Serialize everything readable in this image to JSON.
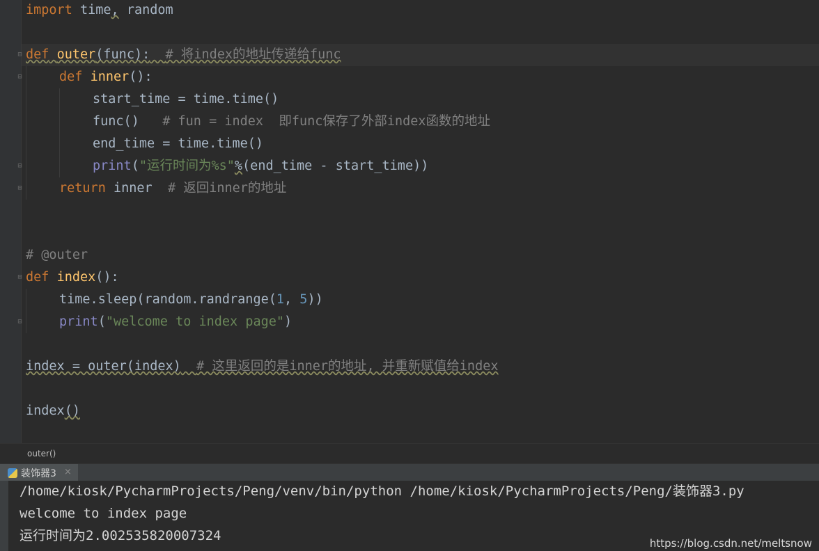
{
  "editor": {
    "line1": {
      "kw": "import",
      "mod1": "time",
      "comma": ",",
      "mod2": "random"
    },
    "line3": {
      "kw": "def",
      "name": "outer",
      "params": "(func):",
      "comment": "# 将index的地址传递给func"
    },
    "line4": {
      "kw": "def",
      "name": "inner",
      "params": "():"
    },
    "line5": {
      "text": "start_time = time.time()"
    },
    "line6": {
      "code": "func()",
      "comment": "# fun = index  即func保存了外部index函数的地址"
    },
    "line7": {
      "text": "end_time = time.time()"
    },
    "line8": {
      "fn": "print",
      "open": "(",
      "str": "\"运行时间为%s\"",
      "pct": "%",
      "rest": "(end_time - start_time))"
    },
    "line9": {
      "kw": "return",
      "val": "inner",
      "comment": "# 返回inner的地址"
    },
    "line12": {
      "comment": "# @outer"
    },
    "line13": {
      "kw": "def",
      "name": "index",
      "params": "():"
    },
    "line14": {
      "pre": "time.sleep(random.randrange(",
      "n1": "1",
      "sep": ", ",
      "n2": "5",
      "post": "))"
    },
    "line15": {
      "fn": "print",
      "open": "(",
      "str": "\"welcome to index page\"",
      "close": ")"
    },
    "line17": {
      "code": "index = outer(index)",
      "comment": "# 这里返回的是inner的地址, 并重新赋值给index"
    },
    "line19": {
      "code": "index",
      "parens": "()"
    }
  },
  "breadcrumb": {
    "text": "outer()"
  },
  "run_panel": {
    "tab_label": "装饰器3",
    "close_label": "×",
    "output": [
      "/home/kiosk/PycharmProjects/Peng/venv/bin/python /home/kiosk/PycharmProjects/Peng/装饰器3.py",
      "welcome to index page",
      "运行时间为2.002535820007324"
    ]
  },
  "watermark": "https://blog.csdn.net/meltsnow",
  "colors": {
    "background": "#2b2b2b",
    "keyword": "#cc7832",
    "function": "#ffc66d",
    "comment": "#808080",
    "string": "#6a8759",
    "number": "#6897bb",
    "builtin": "#8888c6",
    "text": "#a9b7c6"
  }
}
